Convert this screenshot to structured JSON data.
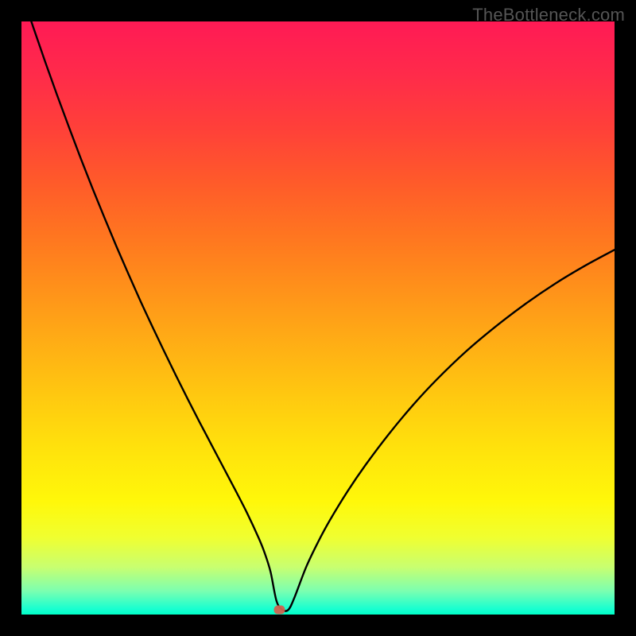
{
  "watermark": "TheBottleneck.com",
  "chart_data": {
    "type": "line",
    "title": "",
    "xlabel": "",
    "ylabel": "",
    "xlim": [
      0,
      100
    ],
    "ylim": [
      0,
      100
    ],
    "grid": false,
    "legend": false,
    "marker": {
      "x": 43.5,
      "y": 0.8,
      "color": "#d1624f"
    },
    "series": [
      {
        "name": "curve",
        "x": [
          0,
          2,
          4,
          6,
          8,
          10,
          12,
          14,
          16,
          18,
          20,
          22,
          24,
          26,
          28,
          30,
          32,
          34,
          36,
          38,
          40,
          41,
          42,
          43,
          44,
          45,
          46,
          48,
          50,
          52,
          55,
          58,
          62,
          66,
          70,
          75,
          80,
          85,
          90,
          95,
          100
        ],
        "values": [
          105,
          99.0,
          93.2,
          87.6,
          82.2,
          76.9,
          71.8,
          66.9,
          62.1,
          57.5,
          53.0,
          48.7,
          44.5,
          40.4,
          36.4,
          32.5,
          28.7,
          24.9,
          21.1,
          17.2,
          12.9,
          10.4,
          7.2,
          2.3,
          0.8,
          0.8,
          2.8,
          8.0,
          12.2,
          15.9,
          20.8,
          25.2,
          30.5,
          35.3,
          39.6,
          44.4,
          48.6,
          52.4,
          55.8,
          58.8,
          61.5
        ]
      }
    ],
    "gradient_colors": {
      "top": "#ff1a55",
      "mid_upper": "#ff911a",
      "mid_lower": "#ffe20c",
      "bottom": "#00ffc8"
    }
  }
}
